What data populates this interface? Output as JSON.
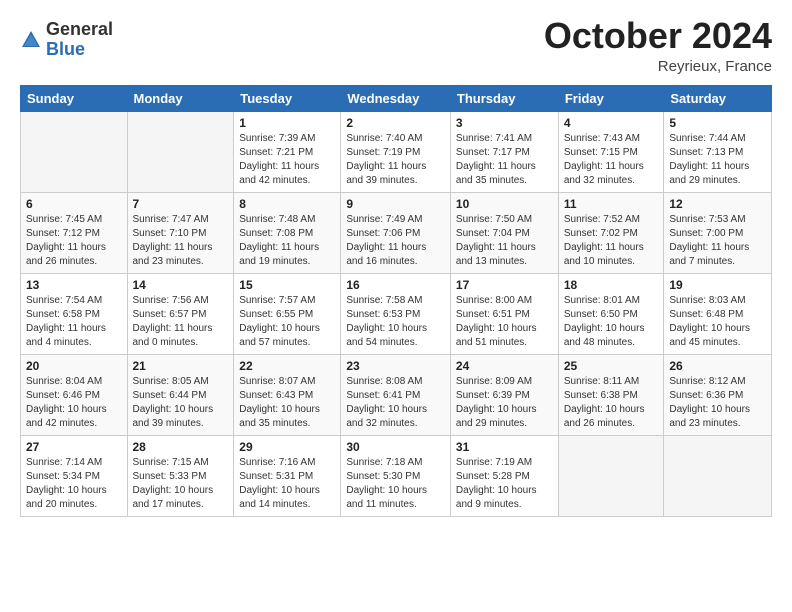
{
  "header": {
    "logo_general": "General",
    "logo_blue": "Blue",
    "month_title": "October 2024",
    "location": "Reyrieux, France"
  },
  "days_of_week": [
    "Sunday",
    "Monday",
    "Tuesday",
    "Wednesday",
    "Thursday",
    "Friday",
    "Saturday"
  ],
  "weeks": [
    [
      {
        "day": "",
        "empty": true
      },
      {
        "day": "",
        "empty": true
      },
      {
        "day": "1",
        "sunrise": "Sunrise: 7:39 AM",
        "sunset": "Sunset: 7:21 PM",
        "daylight": "Daylight: 11 hours and 42 minutes."
      },
      {
        "day": "2",
        "sunrise": "Sunrise: 7:40 AM",
        "sunset": "Sunset: 7:19 PM",
        "daylight": "Daylight: 11 hours and 39 minutes."
      },
      {
        "day": "3",
        "sunrise": "Sunrise: 7:41 AM",
        "sunset": "Sunset: 7:17 PM",
        "daylight": "Daylight: 11 hours and 35 minutes."
      },
      {
        "day": "4",
        "sunrise": "Sunrise: 7:43 AM",
        "sunset": "Sunset: 7:15 PM",
        "daylight": "Daylight: 11 hours and 32 minutes."
      },
      {
        "day": "5",
        "sunrise": "Sunrise: 7:44 AM",
        "sunset": "Sunset: 7:13 PM",
        "daylight": "Daylight: 11 hours and 29 minutes."
      }
    ],
    [
      {
        "day": "6",
        "sunrise": "Sunrise: 7:45 AM",
        "sunset": "Sunset: 7:12 PM",
        "daylight": "Daylight: 11 hours and 26 minutes."
      },
      {
        "day": "7",
        "sunrise": "Sunrise: 7:47 AM",
        "sunset": "Sunset: 7:10 PM",
        "daylight": "Daylight: 11 hours and 23 minutes."
      },
      {
        "day": "8",
        "sunrise": "Sunrise: 7:48 AM",
        "sunset": "Sunset: 7:08 PM",
        "daylight": "Daylight: 11 hours and 19 minutes."
      },
      {
        "day": "9",
        "sunrise": "Sunrise: 7:49 AM",
        "sunset": "Sunset: 7:06 PM",
        "daylight": "Daylight: 11 hours and 16 minutes."
      },
      {
        "day": "10",
        "sunrise": "Sunrise: 7:50 AM",
        "sunset": "Sunset: 7:04 PM",
        "daylight": "Daylight: 11 hours and 13 minutes."
      },
      {
        "day": "11",
        "sunrise": "Sunrise: 7:52 AM",
        "sunset": "Sunset: 7:02 PM",
        "daylight": "Daylight: 11 hours and 10 minutes."
      },
      {
        "day": "12",
        "sunrise": "Sunrise: 7:53 AM",
        "sunset": "Sunset: 7:00 PM",
        "daylight": "Daylight: 11 hours and 7 minutes."
      }
    ],
    [
      {
        "day": "13",
        "sunrise": "Sunrise: 7:54 AM",
        "sunset": "Sunset: 6:58 PM",
        "daylight": "Daylight: 11 hours and 4 minutes."
      },
      {
        "day": "14",
        "sunrise": "Sunrise: 7:56 AM",
        "sunset": "Sunset: 6:57 PM",
        "daylight": "Daylight: 11 hours and 0 minutes."
      },
      {
        "day": "15",
        "sunrise": "Sunrise: 7:57 AM",
        "sunset": "Sunset: 6:55 PM",
        "daylight": "Daylight: 10 hours and 57 minutes."
      },
      {
        "day": "16",
        "sunrise": "Sunrise: 7:58 AM",
        "sunset": "Sunset: 6:53 PM",
        "daylight": "Daylight: 10 hours and 54 minutes."
      },
      {
        "day": "17",
        "sunrise": "Sunrise: 8:00 AM",
        "sunset": "Sunset: 6:51 PM",
        "daylight": "Daylight: 10 hours and 51 minutes."
      },
      {
        "day": "18",
        "sunrise": "Sunrise: 8:01 AM",
        "sunset": "Sunset: 6:50 PM",
        "daylight": "Daylight: 10 hours and 48 minutes."
      },
      {
        "day": "19",
        "sunrise": "Sunrise: 8:03 AM",
        "sunset": "Sunset: 6:48 PM",
        "daylight": "Daylight: 10 hours and 45 minutes."
      }
    ],
    [
      {
        "day": "20",
        "sunrise": "Sunrise: 8:04 AM",
        "sunset": "Sunset: 6:46 PM",
        "daylight": "Daylight: 10 hours and 42 minutes."
      },
      {
        "day": "21",
        "sunrise": "Sunrise: 8:05 AM",
        "sunset": "Sunset: 6:44 PM",
        "daylight": "Daylight: 10 hours and 39 minutes."
      },
      {
        "day": "22",
        "sunrise": "Sunrise: 8:07 AM",
        "sunset": "Sunset: 6:43 PM",
        "daylight": "Daylight: 10 hours and 35 minutes."
      },
      {
        "day": "23",
        "sunrise": "Sunrise: 8:08 AM",
        "sunset": "Sunset: 6:41 PM",
        "daylight": "Daylight: 10 hours and 32 minutes."
      },
      {
        "day": "24",
        "sunrise": "Sunrise: 8:09 AM",
        "sunset": "Sunset: 6:39 PM",
        "daylight": "Daylight: 10 hours and 29 minutes."
      },
      {
        "day": "25",
        "sunrise": "Sunrise: 8:11 AM",
        "sunset": "Sunset: 6:38 PM",
        "daylight": "Daylight: 10 hours and 26 minutes."
      },
      {
        "day": "26",
        "sunrise": "Sunrise: 8:12 AM",
        "sunset": "Sunset: 6:36 PM",
        "daylight": "Daylight: 10 hours and 23 minutes."
      }
    ],
    [
      {
        "day": "27",
        "sunrise": "Sunrise: 7:14 AM",
        "sunset": "Sunset: 5:34 PM",
        "daylight": "Daylight: 10 hours and 20 minutes."
      },
      {
        "day": "28",
        "sunrise": "Sunrise: 7:15 AM",
        "sunset": "Sunset: 5:33 PM",
        "daylight": "Daylight: 10 hours and 17 minutes."
      },
      {
        "day": "29",
        "sunrise": "Sunrise: 7:16 AM",
        "sunset": "Sunset: 5:31 PM",
        "daylight": "Daylight: 10 hours and 14 minutes."
      },
      {
        "day": "30",
        "sunrise": "Sunrise: 7:18 AM",
        "sunset": "Sunset: 5:30 PM",
        "daylight": "Daylight: 10 hours and 11 minutes."
      },
      {
        "day": "31",
        "sunrise": "Sunrise: 7:19 AM",
        "sunset": "Sunset: 5:28 PM",
        "daylight": "Daylight: 10 hours and 9 minutes."
      },
      {
        "day": "",
        "empty": true
      },
      {
        "day": "",
        "empty": true
      }
    ]
  ]
}
